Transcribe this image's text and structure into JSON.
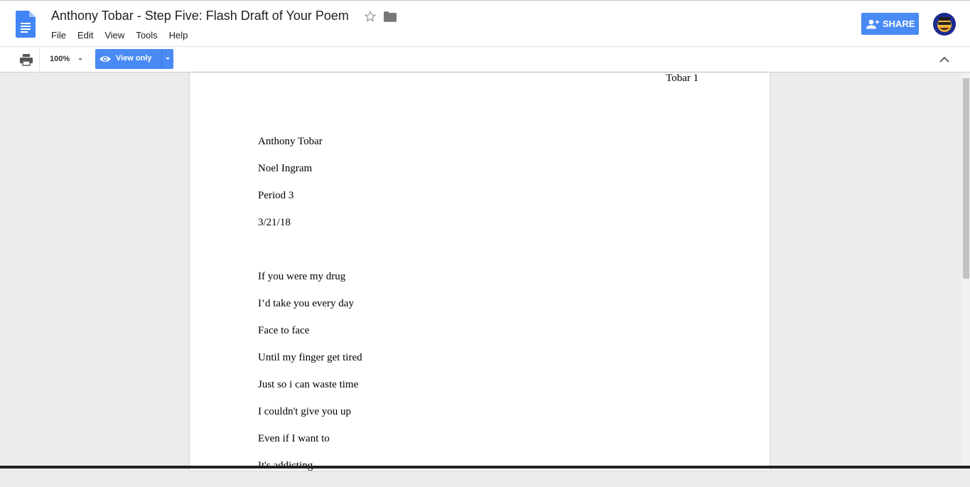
{
  "document": {
    "title": "Anthony Tobar - Step Five: Flash Draft of Your Poem",
    "icon": "google-docs-icon"
  },
  "menu": [
    "File",
    "Edit",
    "View",
    "Tools",
    "Help"
  ],
  "share": {
    "label": "SHARE",
    "icon": "person-add-icon",
    "color": "#4a8af4"
  },
  "toolbar": {
    "zoom": "100%",
    "mode_label": "View only",
    "mode_icon": "eye-icon"
  },
  "page": {
    "header": "Tobar 1",
    "heading_lines": [
      "Anthony Tobar",
      "Noel Ingram",
      "Period 3",
      "3/21/18"
    ],
    "poem_lines": [
      "If you were my drug",
      "I’d take you every day",
      "Face to face",
      "Until my finger get tired",
      "Just so i can waste time",
      "I couldn't give you up",
      "Even if I want to",
      "It's addicting"
    ]
  }
}
